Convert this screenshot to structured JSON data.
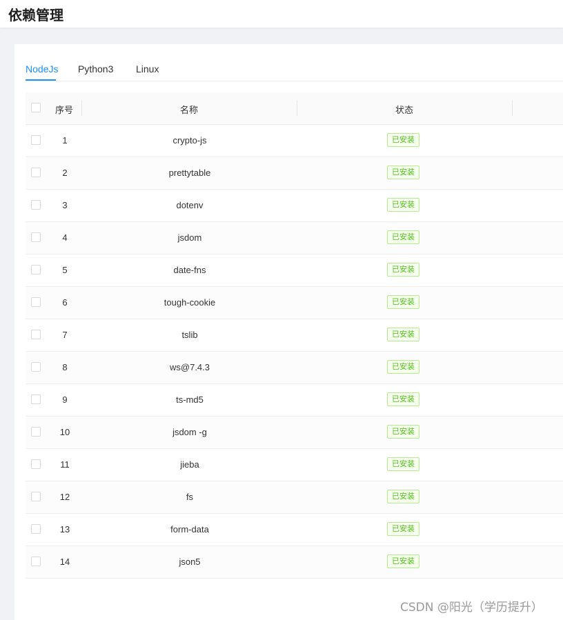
{
  "header": {
    "title": "依赖管理"
  },
  "tabs": [
    {
      "label": "NodeJs",
      "active": true
    },
    {
      "label": "Python3",
      "active": false
    },
    {
      "label": "Linux",
      "active": false
    }
  ],
  "table": {
    "columns": {
      "index": "序号",
      "name": "名称",
      "status": "状态"
    },
    "rows": [
      {
        "index": "1",
        "name": "crypto-js",
        "status": "已安装"
      },
      {
        "index": "2",
        "name": "prettytable",
        "status": "已安装"
      },
      {
        "index": "3",
        "name": "dotenv",
        "status": "已安装"
      },
      {
        "index": "4",
        "name": "jsdom",
        "status": "已安装"
      },
      {
        "index": "5",
        "name": "date-fns",
        "status": "已安装"
      },
      {
        "index": "6",
        "name": "tough-cookie",
        "status": "已安装"
      },
      {
        "index": "7",
        "name": "tslib",
        "status": "已安装"
      },
      {
        "index": "8",
        "name": "ws@7.4.3",
        "status": "已安装"
      },
      {
        "index": "9",
        "name": "ts-md5",
        "status": "已安装"
      },
      {
        "index": "10",
        "name": "jsdom -g",
        "status": "已安装"
      },
      {
        "index": "11",
        "name": "jieba",
        "status": "已安装"
      },
      {
        "index": "12",
        "name": "fs",
        "status": "已安装"
      },
      {
        "index": "13",
        "name": "form-data",
        "status": "已安装"
      },
      {
        "index": "14",
        "name": "json5",
        "status": "已安装"
      }
    ]
  },
  "watermark": "CSDN @阳光（学历提升）",
  "colors": {
    "accent": "#1890ff",
    "status_installed": "#52c41a",
    "page_background": "#f0f2f5"
  }
}
